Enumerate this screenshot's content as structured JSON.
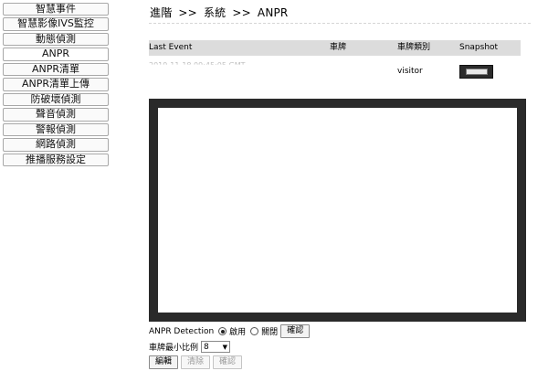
{
  "sidebar": {
    "items": [
      {
        "label": "智慧事件"
      },
      {
        "label": "智慧影像IVS監控"
      },
      {
        "label": "動態偵測"
      },
      {
        "label": "ANPR"
      },
      {
        "label": "ANPR清單"
      },
      {
        "label": "ANPR清單上傳"
      },
      {
        "label": "防破壞偵測"
      },
      {
        "label": "聲音偵測"
      },
      {
        "label": "警報偵測"
      },
      {
        "label": "網路偵測"
      },
      {
        "label": "推播服務設定"
      }
    ],
    "active_index": 3
  },
  "breadcrumb": {
    "items": [
      "進階",
      "系統",
      "ANPR"
    ],
    "separator": ">>"
  },
  "event_table": {
    "headers": [
      "Last Event",
      "車牌",
      "車牌類別",
      "Snapshot"
    ],
    "row": {
      "last_event": "2019-11-18 09:45:05 GMT",
      "plate": "",
      "category": "visitor"
    }
  },
  "controls": {
    "detection_label": "ANPR Detection",
    "enable_label": "啟用",
    "disable_label": "關閉",
    "detection_enabled": true,
    "confirm_label": "確認",
    "min_ratio_label": "車牌最小比例",
    "min_ratio_value": "8",
    "edit_label": "編輯",
    "clear_label": "清除",
    "confirm2_label": "確認"
  },
  "colors": {
    "table_header_bg": "#dcdcdc",
    "video_border": "#2a2a2a"
  }
}
